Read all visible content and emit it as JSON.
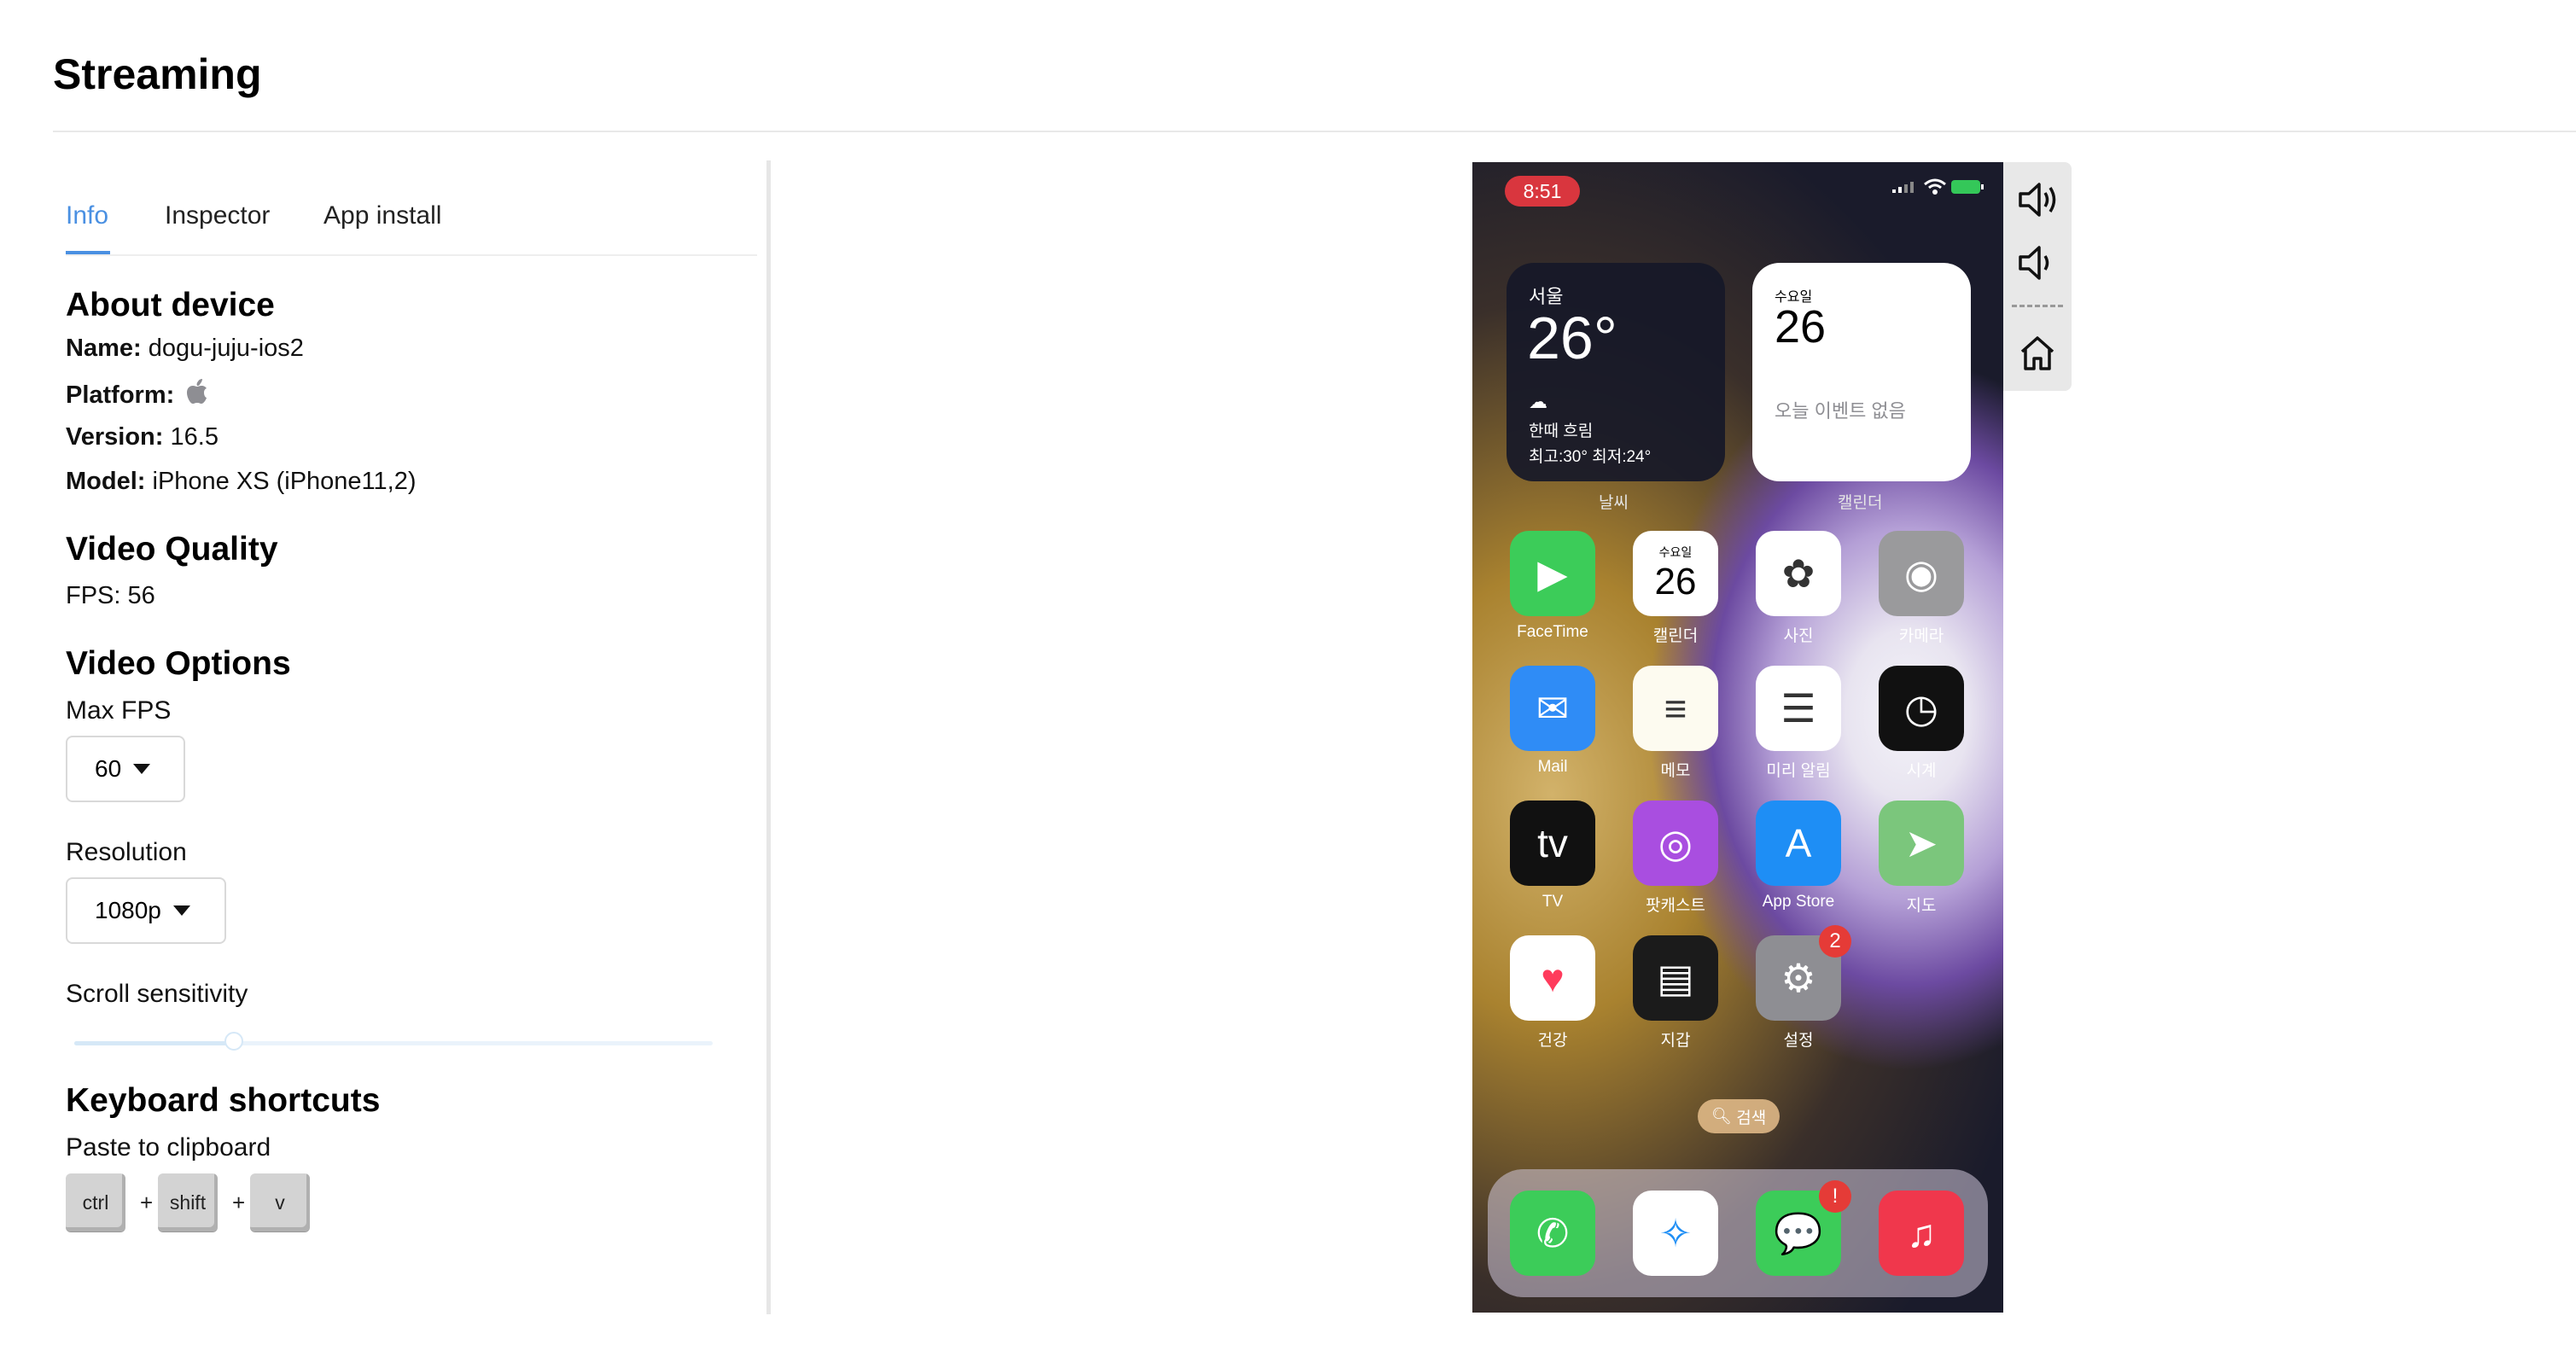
{
  "header": {
    "title": "Streaming"
  },
  "tabs": [
    {
      "label": "Info",
      "active": true
    },
    {
      "label": "Inspector"
    },
    {
      "label": "App install"
    }
  ],
  "about": {
    "title": "About device",
    "name_label": "Name:",
    "name_value": "dogu-juju-ios2",
    "platform_label": "Platform:",
    "platform_icon": "apple-icon",
    "version_label": "Version:",
    "version_value": "16.5",
    "model_label": "Model:",
    "model_value": "iPhone XS (iPhone11,2)"
  },
  "video_quality": {
    "title": "Video Quality",
    "fps_text": "FPS: 56"
  },
  "video_options": {
    "title": "Video Options",
    "max_fps_label": "Max FPS",
    "max_fps_value": "60",
    "resolution_label": "Resolution",
    "resolution_value": "1080p",
    "scroll_label": "Scroll sensitivity",
    "scroll_value": 0.25
  },
  "keyboard": {
    "title": "Keyboard shortcuts",
    "paste_label": "Paste to clipboard",
    "keys": [
      "ctrl",
      "shift",
      "v"
    ],
    "plus": "+"
  },
  "phone": {
    "time": "8:51",
    "weather": {
      "city": "서울",
      "temp": "26°",
      "condition": "한때 흐림",
      "range": "최고:30° 최저:24°",
      "label": "날씨"
    },
    "calendar_widget": {
      "weekday": "수요일",
      "day": "26",
      "events": "오늘 이벤트 없음",
      "label": "캘린더"
    },
    "apps": [
      {
        "label": "FaceTime",
        "color": "#3ccc59",
        "glyph": "▶"
      },
      {
        "label": "캘린더",
        "color": "#ffffff",
        "glyph": "26",
        "weekday": "수요일"
      },
      {
        "label": "사진",
        "color": "#ffffff",
        "glyph": "✿"
      },
      {
        "label": "카메라",
        "color": "#9a9a9c",
        "glyph": "◉"
      },
      {
        "label": "Mail",
        "color": "#2f8cf6",
        "glyph": "✉"
      },
      {
        "label": "메모",
        "color": "#fdfbf0",
        "glyph": "≡"
      },
      {
        "label": "미리 알림",
        "color": "#ffffff",
        "glyph": "☰"
      },
      {
        "label": "시계",
        "color": "#111111",
        "glyph": "◷"
      },
      {
        "label": "TV",
        "color": "#111111",
        "glyph": "tv"
      },
      {
        "label": "팟캐스트",
        "color": "#a94ee0",
        "glyph": "◎"
      },
      {
        "label": "App Store",
        "color": "#1e8ef5",
        "glyph": "A"
      },
      {
        "label": "지도",
        "color": "#7bc67c",
        "glyph": "➤"
      },
      {
        "label": "건강",
        "color": "#ffffff",
        "glyph": "♥"
      },
      {
        "label": "지갑",
        "color": "#1b1b1b",
        "glyph": "▤"
      },
      {
        "label": "설정",
        "color": "#8e8e93",
        "glyph": "⚙",
        "badge": "2"
      }
    ],
    "search_label": "검색",
    "dock": [
      {
        "name": "phone",
        "color": "#3ccc59",
        "glyph": "✆"
      },
      {
        "name": "safari",
        "color": "#ffffff",
        "glyph": "✧"
      },
      {
        "name": "messages",
        "color": "#3ccc59",
        "glyph": "💬",
        "badge": "!"
      },
      {
        "name": "music",
        "color": "#f0374c",
        "glyph": "♫"
      }
    ]
  },
  "controls": [
    "volume-up-icon",
    "volume-down-icon",
    "home-icon"
  ]
}
